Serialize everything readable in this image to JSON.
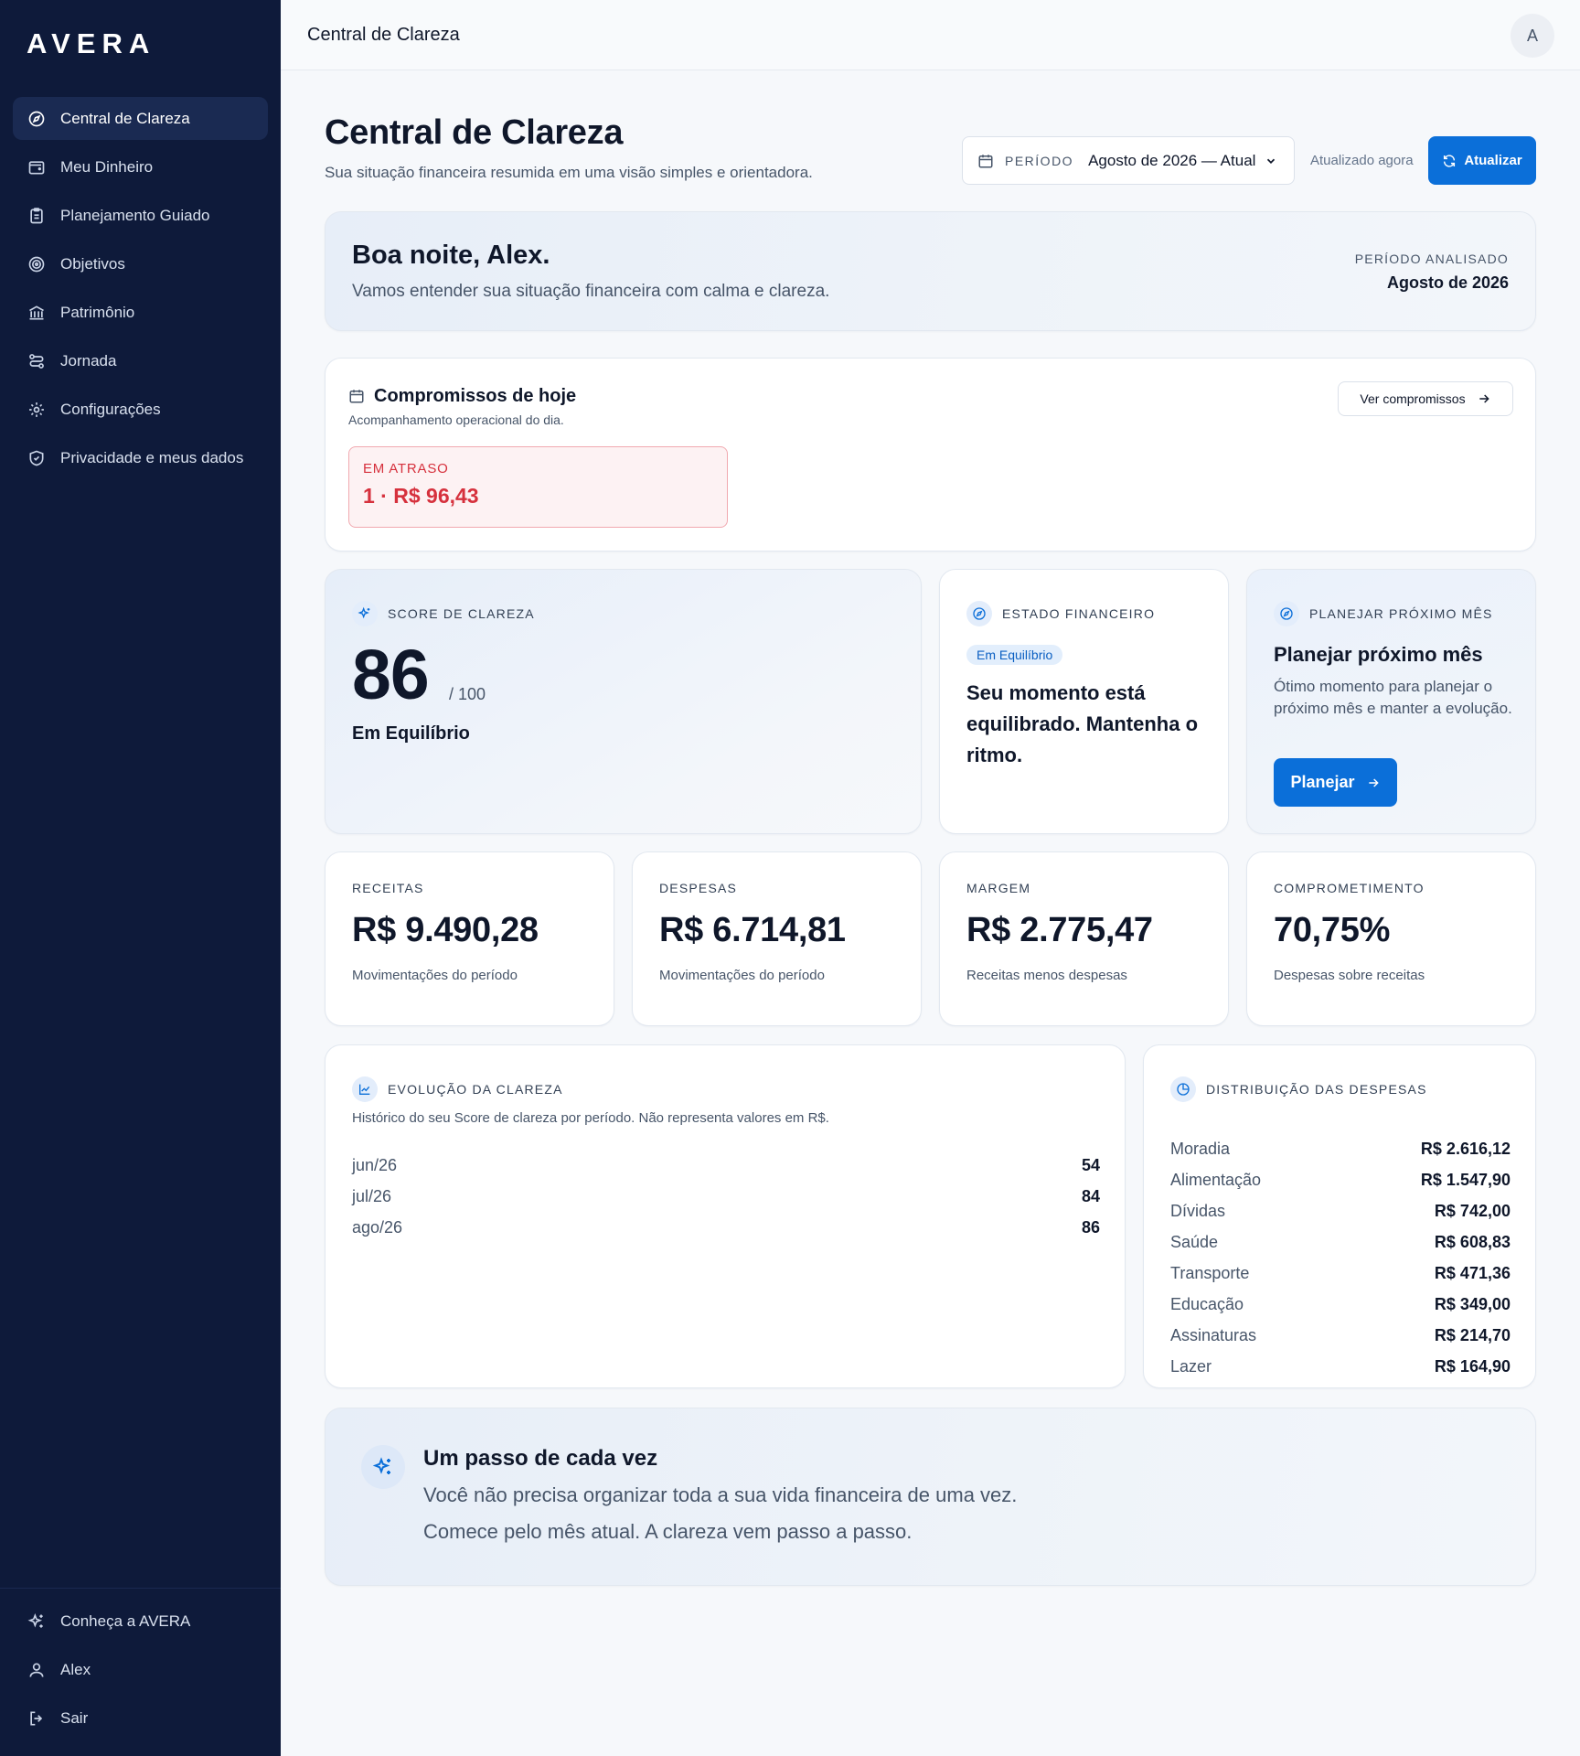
{
  "brand": "AVERA",
  "sidebar": {
    "items": [
      {
        "label": "Central de Clareza",
        "icon": "compass-icon",
        "active": true
      },
      {
        "label": "Meu Dinheiro",
        "icon": "wallet-icon"
      },
      {
        "label": "Planejamento Guiado",
        "icon": "clipboard-icon"
      },
      {
        "label": "Objetivos",
        "icon": "target-icon"
      },
      {
        "label": "Patrimônio",
        "icon": "bank-icon"
      },
      {
        "label": "Jornada",
        "icon": "route-icon"
      },
      {
        "label": "Configurações",
        "icon": "gear-icon"
      },
      {
        "label": "Privacidade e meus dados",
        "icon": "shield-icon"
      }
    ],
    "bottom": [
      {
        "label": "Conheça a AVERA",
        "icon": "sparkles-icon"
      },
      {
        "label": "Alex",
        "icon": "user-icon"
      },
      {
        "label": "Sair",
        "icon": "logout-icon"
      }
    ]
  },
  "topbar": {
    "title": "Central de Clareza",
    "avatar": "A"
  },
  "header": {
    "title": "Central de Clareza",
    "subtitle": "Sua situação financeira resumida em uma visão simples e orientadora.",
    "period_label": "PERÍODO",
    "period_value": "Agosto de 2026 — Atual",
    "updated": "Atualizado agora",
    "refresh_label": "Atualizar"
  },
  "greeting": {
    "title": "Boa noite, Alex.",
    "subtitle": "Vamos entender sua situação financeira com calma e clareza.",
    "period_label": "PERÍODO ANALISADO",
    "period_value": "Agosto de 2026"
  },
  "commitments": {
    "title": "Compromissos de hoje",
    "subtitle": "Acompanhamento operacional do dia.",
    "button": "Ver compromissos",
    "overdue_label": "EM ATRASO",
    "overdue_value": "1 · R$ 96,43"
  },
  "score": {
    "label": "SCORE DE CLAREZA",
    "value": "86",
    "max": "/ 100",
    "status": "Em Equilíbrio"
  },
  "state": {
    "label": "ESTADO FINANCEIRO",
    "pill": "Em Equilíbrio",
    "text": "Seu momento está equilibrado. Mantenha o ritmo."
  },
  "plan": {
    "label": "PLANEJAR PRÓXIMO MÊS",
    "title": "Planejar próximo mês",
    "text": "Ótimo momento para planejar o próximo mês e manter a evolução.",
    "button": "Planejar"
  },
  "kpis": [
    {
      "label": "RECEITAS",
      "value": "R$ 9.490,28",
      "sub": "Movimentações do período"
    },
    {
      "label": "DESPESAS",
      "value": "R$ 6.714,81",
      "sub": "Movimentações do período"
    },
    {
      "label": "MARGEM",
      "value": "R$ 2.775,47",
      "sub": "Receitas menos despesas"
    },
    {
      "label": "COMPROMETIMENTO",
      "value": "70,75%",
      "sub": "Despesas sobre receitas"
    }
  ],
  "evolution": {
    "label": "EVOLUÇÃO DA CLAREZA",
    "subtitle": "Histórico do seu Score de clareza por período. Não representa valores em R$.",
    "rows": [
      {
        "period": "jun/26",
        "score": "54"
      },
      {
        "period": "jul/26",
        "score": "84"
      },
      {
        "period": "ago/26",
        "score": "86"
      }
    ]
  },
  "distribution": {
    "label": "DISTRIBUIÇÃO DAS DESPESAS",
    "rows": [
      {
        "category": "Moradia",
        "value": "R$ 2.616,12"
      },
      {
        "category": "Alimentação",
        "value": "R$ 1.547,90"
      },
      {
        "category": "Dívidas",
        "value": "R$ 742,00"
      },
      {
        "category": "Saúde",
        "value": "R$ 608,83"
      },
      {
        "category": "Transporte",
        "value": "R$ 471,36"
      },
      {
        "category": "Educação",
        "value": "R$ 349,00"
      },
      {
        "category": "Assinaturas",
        "value": "R$ 214,70"
      },
      {
        "category": "Lazer",
        "value": "R$ 164,90"
      }
    ]
  },
  "step": {
    "title": "Um passo de cada vez",
    "line1": "Você não precisa organizar toda a sua vida financeira de uma vez.",
    "line2": "Comece pelo mês atual. A clareza vem passo a passo."
  },
  "colors": {
    "sidebar_bg": "#0e1a3a",
    "accent": "#0b6fd9",
    "danger": "#d6313d"
  }
}
